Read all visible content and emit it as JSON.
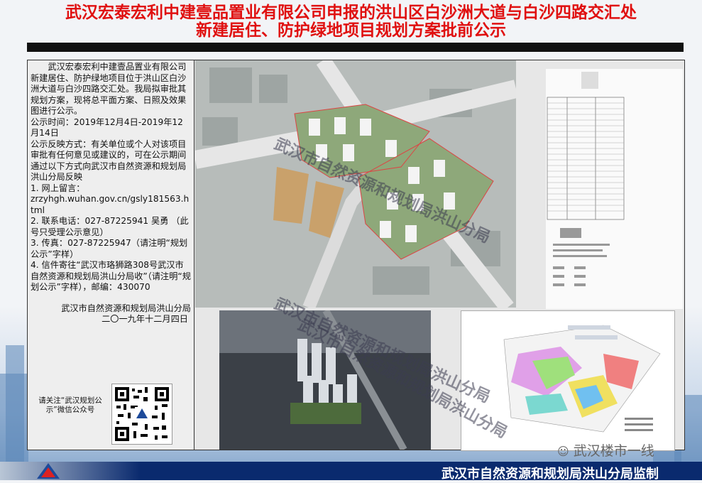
{
  "title": {
    "line1": "武汉宏泰宏利中建壹品置业有限公司申报的洪山区白沙洲大道与白沙四路交汇处",
    "line2": "新建居住、防护绿地项目规划方案批前公示"
  },
  "notice": {
    "intro": "武汉宏泰宏利中建壹品置业有限公司新建居住、防护绿地项目位于洪山区白沙洲大道与白沙四路交汇处。我局拟审批其规划方案，现将总平面方案、日照及效果图进行公示。",
    "period": "公示时间：2019年12月4日-2019年12月14日",
    "feedback": "公示反映方式：有关单位或个人对该项目审批有任何意见或建议的，可在公示期间通过以下方式向武汉市自然资源和规划局洪山分局反映",
    "item1": "1. 网上留言：",
    "url": "zrzyhgh.wuhan.gov.cn/gsly181563.html",
    "item2": "2. 联系电话：027-87225941 吴勇 （此号只受理公示意见）",
    "item3": "3. 传真：027-87225947（请注明“规划公示”字样）",
    "item4": "4. 信件寄往“武汉市珞狮路308号武汉市自然资源和规划局洪山分局收”（请注明“规划公示”字样），邮编：430070",
    "agency": "武汉市自然资源和规划局洪山分局",
    "date": "二〇一九年十二月四日",
    "qr_label": "请关注“武汉规划公示”微信公众号"
  },
  "watermark": {
    "text1": "武汉市自然资源和规划局洪山分局",
    "text2": "武汉市自然资源和规划局洪山分局",
    "text3": "武汉市自然资源和规划局洪山分局"
  },
  "wechat_account": "武汉楼市一线",
  "footer": "武汉市自然资源和规划局洪山分局监制",
  "colors": {
    "title_red": "#e01010",
    "footer_navy": "#0a2a6e"
  },
  "icons": [
    "wechat-icon",
    "qr-code",
    "bureau-logo-icon"
  ]
}
